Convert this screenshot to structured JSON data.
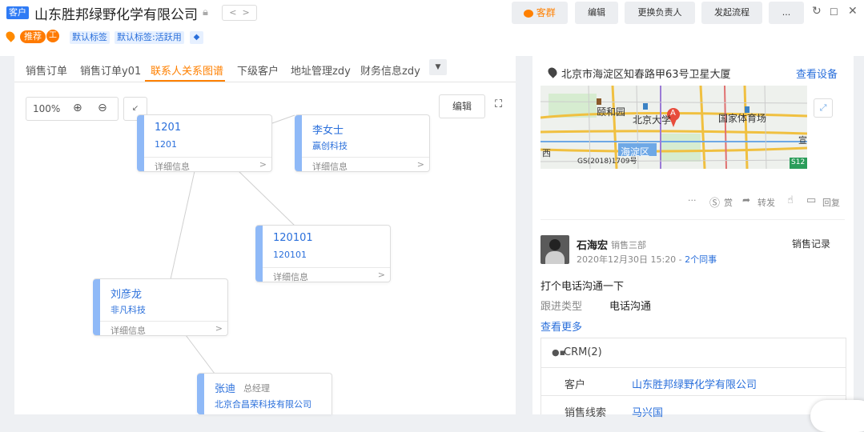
{
  "header": {
    "type_badge": "客户",
    "company_name": "山东胜邦绿野化学有限公司",
    "recommend_badge": "推荐",
    "small_badge": "工",
    "tags": [
      "默认标签",
      "默认标签:活跃用"
    ],
    "buttons": {
      "group": "客群",
      "edit": "编辑",
      "change_owner": "更换负责人",
      "start_flow": "发起流程",
      "more": "..."
    }
  },
  "tabs": [
    "销售订单",
    "销售订单y01",
    "联系人关系图谱",
    "下级客户",
    "地址管理zdy",
    "财务信息zdy"
  ],
  "active_tab": "联系人关系图谱",
  "graph_toolbar": {
    "zoom": "100%",
    "edit": "编辑"
  },
  "nodes": [
    {
      "name": "1201",
      "sub": "1201",
      "detail": "详细信息",
      "chev": ">"
    },
    {
      "name": "李女士",
      "sub": "赢创科技",
      "detail": "详细信息",
      "chev": ">"
    },
    {
      "name": "120101",
      "sub": "120101",
      "detail": "详细信息",
      "chev": ">"
    },
    {
      "name": "刘彦龙",
      "sub": "非凡科技",
      "detail": "详细信息",
      "chev": ">"
    },
    {
      "name": "张迪",
      "title": "总经理",
      "sub": "北京合昌荣科技有限公司",
      "detail": "",
      "chev": ""
    }
  ],
  "map_card": {
    "address": "北京市海淀区知春路甲63号卫星大厦",
    "view_device": "查看设备",
    "labels": {
      "yiheyuan": "颐和园",
      "pku": "北京大学",
      "stadium": "国家体育场",
      "haidian": "海淀区",
      "gs": "GS(2018)1709号",
      "xi": "西",
      "xuan": "宣",
      "s12": "S12",
      "marker": "A"
    }
  },
  "actions": {
    "more": "···",
    "reward": "赏",
    "forward": "转发",
    "reply": "回复"
  },
  "activity": {
    "user": "石海宏",
    "dept": "销售三部",
    "record_link": "销售记录",
    "time": "2020年12月30日 15:20",
    "sep": " - ",
    "colleagues": "2个同事",
    "content": "打个电话沟通一下",
    "follow_label": "跟进类型",
    "follow_value": "电话沟通",
    "more": "查看更多"
  },
  "crm": {
    "title": "CRM(2)",
    "rows": [
      {
        "label": "客户",
        "value": "山东胜邦绿野化学有限公司"
      },
      {
        "label": "销售线索",
        "value": "马兴国"
      }
    ]
  },
  "colors": {
    "orange": "#ff8000",
    "blue": "#2a6fdb",
    "node_bar": "#8fb9f7",
    "badge_blue": "#1677ff"
  }
}
